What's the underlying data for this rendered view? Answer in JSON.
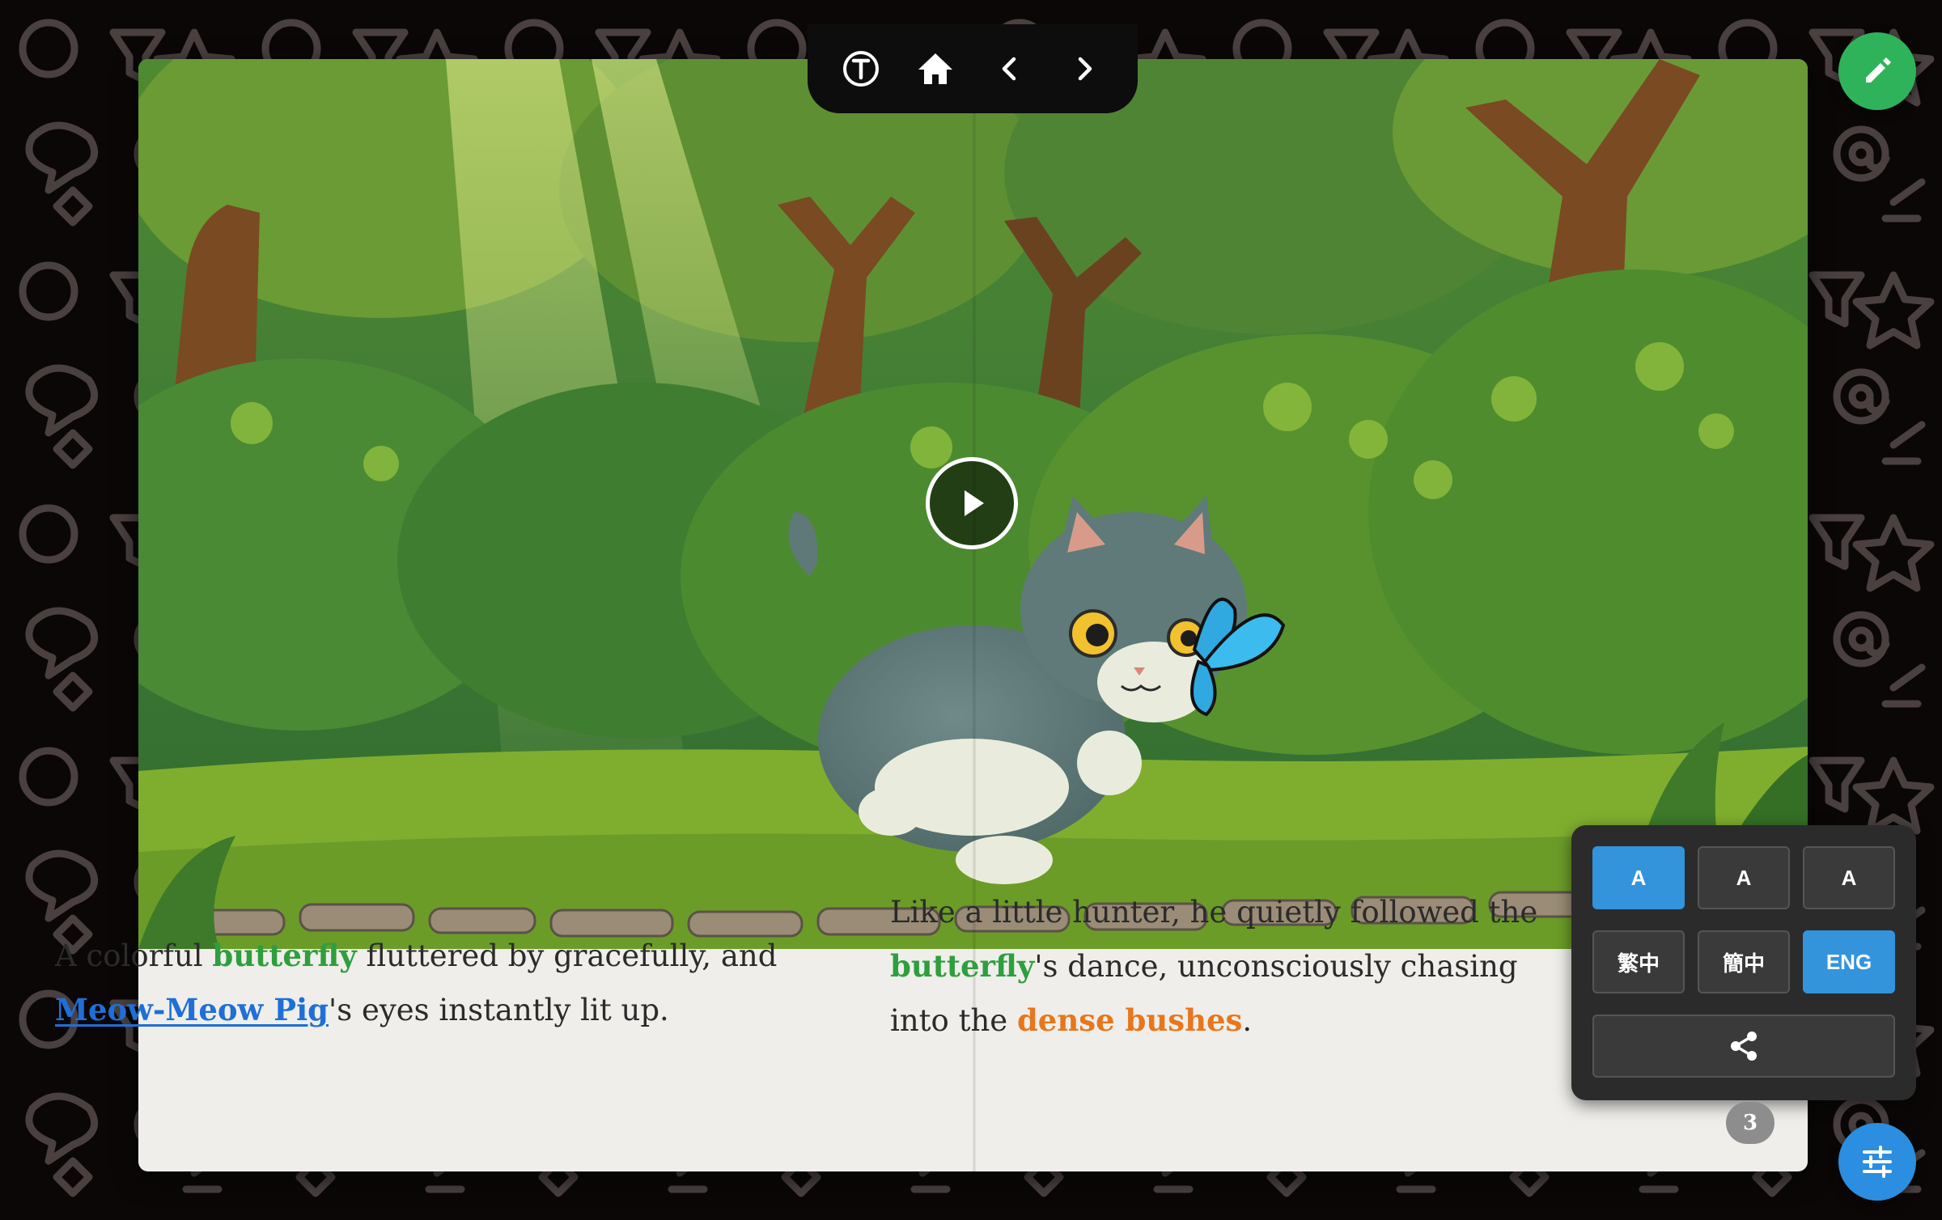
{
  "nav": {
    "icons": [
      "text-toggle-icon",
      "home-icon",
      "chevron-left-icon",
      "chevron-right-icon"
    ]
  },
  "story": {
    "left_page": {
      "seg1": "A colorful ",
      "word1": "butterfly",
      "seg2": " fluttered by gracefully, and",
      "name": "Meow-Meow Pig",
      "seg3": "'s eyes instantly lit up."
    },
    "right_page": {
      "seg1": "Like a little hunter, he quietly followed the",
      "word1": "butterfly",
      "seg2": "'s dance, unconsciously chasing",
      "seg3": "into the ",
      "phrase": "dense bushes",
      "seg4": "."
    },
    "page_number": "3"
  },
  "settings": {
    "font_sizes": [
      {
        "label": "A",
        "active": true
      },
      {
        "label": "A",
        "active": false
      },
      {
        "label": "A",
        "active": false
      }
    ],
    "languages": [
      {
        "label": "繁中",
        "active": false
      },
      {
        "label": "簡中",
        "active": false
      },
      {
        "label": "ENG",
        "active": true
      }
    ],
    "share_icon": "share-icon"
  },
  "colors": {
    "keyword_green": "#2f9e3e",
    "character_blue": "#1f6fd6",
    "place_orange": "#e8761c",
    "accent_blue": "#3394dc",
    "edit_green": "#2fb35a"
  }
}
